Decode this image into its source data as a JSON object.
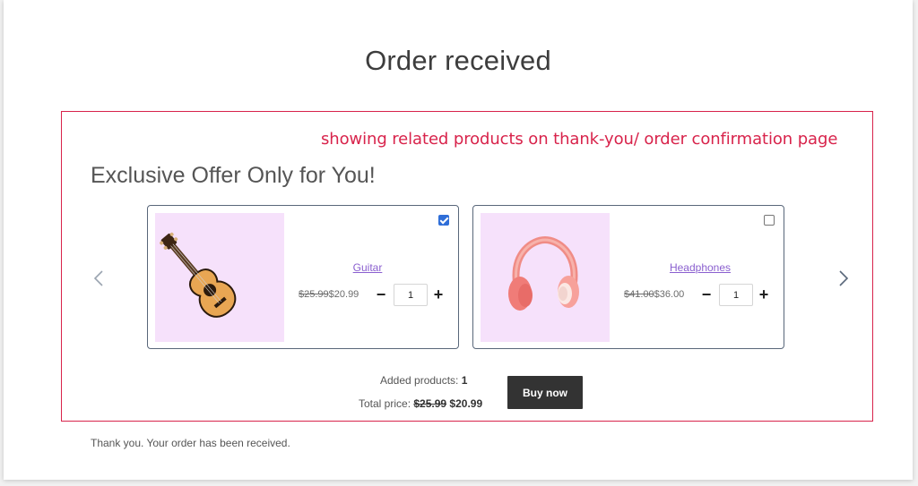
{
  "page": {
    "title": "Order received"
  },
  "annotation": {
    "text": "showing related products on thank-you/ order confirmation page",
    "color": "#d8234b"
  },
  "offer": {
    "heading": "Exclusive Offer Only for You!",
    "products": [
      {
        "name": "Guitar",
        "old_price": "$25.99",
        "new_price": "$20.99",
        "quantity": "1",
        "checked": true,
        "image": "guitar-image"
      },
      {
        "name": "Headphones",
        "old_price": "$41.00",
        "new_price": "$36.00",
        "quantity": "1",
        "checked": false,
        "image": "headphones-image"
      }
    ],
    "qty_minus": "−",
    "qty_plus": "+",
    "prev_icon": "chevron-left-icon",
    "next_icon": "chevron-right-icon"
  },
  "summary": {
    "added_label": "Added products:",
    "added_count": "1",
    "total_label": "Total price:",
    "total_old": "$25.99",
    "total_new": "$20.99",
    "buy_label": "Buy now"
  },
  "footer": {
    "thank_you": "Thank you. Your order has been received."
  },
  "colors": {
    "accent": "#8a5fcf",
    "image_bg": "#f6e1fb",
    "button_bg": "#333333",
    "checkbox": "#2f6ed8"
  }
}
